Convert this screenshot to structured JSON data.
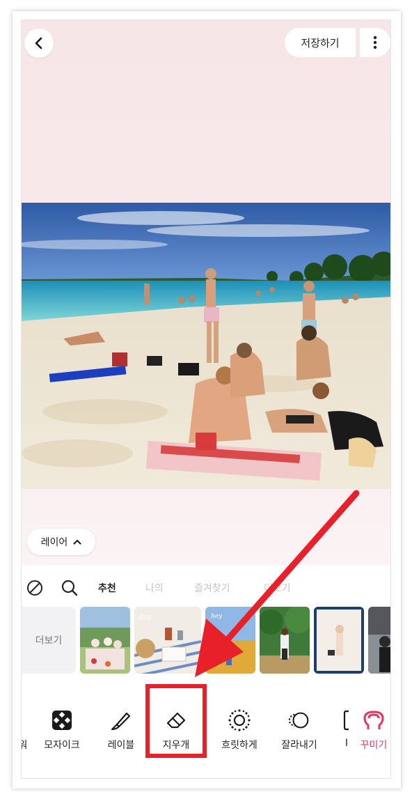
{
  "header": {
    "save_label": "저장하기"
  },
  "layer_button": {
    "label": "레이어"
  },
  "sticker_tabs": [
    {
      "label": "추천",
      "active": true
    },
    {
      "label": "나의",
      "active": false
    },
    {
      "label": "즐겨찾기",
      "active": false
    },
    {
      "label": "더보기",
      "active": false
    }
  ],
  "thumbs": {
    "more_label": "더보기",
    "items": [
      "picnic-friends",
      "picnic-blanket-day",
      "wheat-field",
      "orchard-girl",
      "poster-woman",
      "dark-portrait"
    ]
  },
  "toolbar": {
    "items": [
      {
        "label": "워",
        "icon": "partial-icon"
      },
      {
        "label": "모자이크",
        "icon": "mosaic-icon"
      },
      {
        "label": "레이블",
        "icon": "brush-icon"
      },
      {
        "label": "지우개",
        "icon": "eraser-icon",
        "highlighted": true
      },
      {
        "label": "흐릿하게",
        "icon": "blur-icon"
      },
      {
        "label": "잘라내기",
        "icon": "lasso-icon"
      },
      {
        "label": "I",
        "icon": "partial-icon"
      },
      {
        "label": "꾸미기",
        "icon": "decorate-icon",
        "accent": true
      }
    ]
  },
  "colors": {
    "accent": "#e9355a",
    "highlight": "#e8202a",
    "canvas_bg": "#f7e6e8"
  }
}
